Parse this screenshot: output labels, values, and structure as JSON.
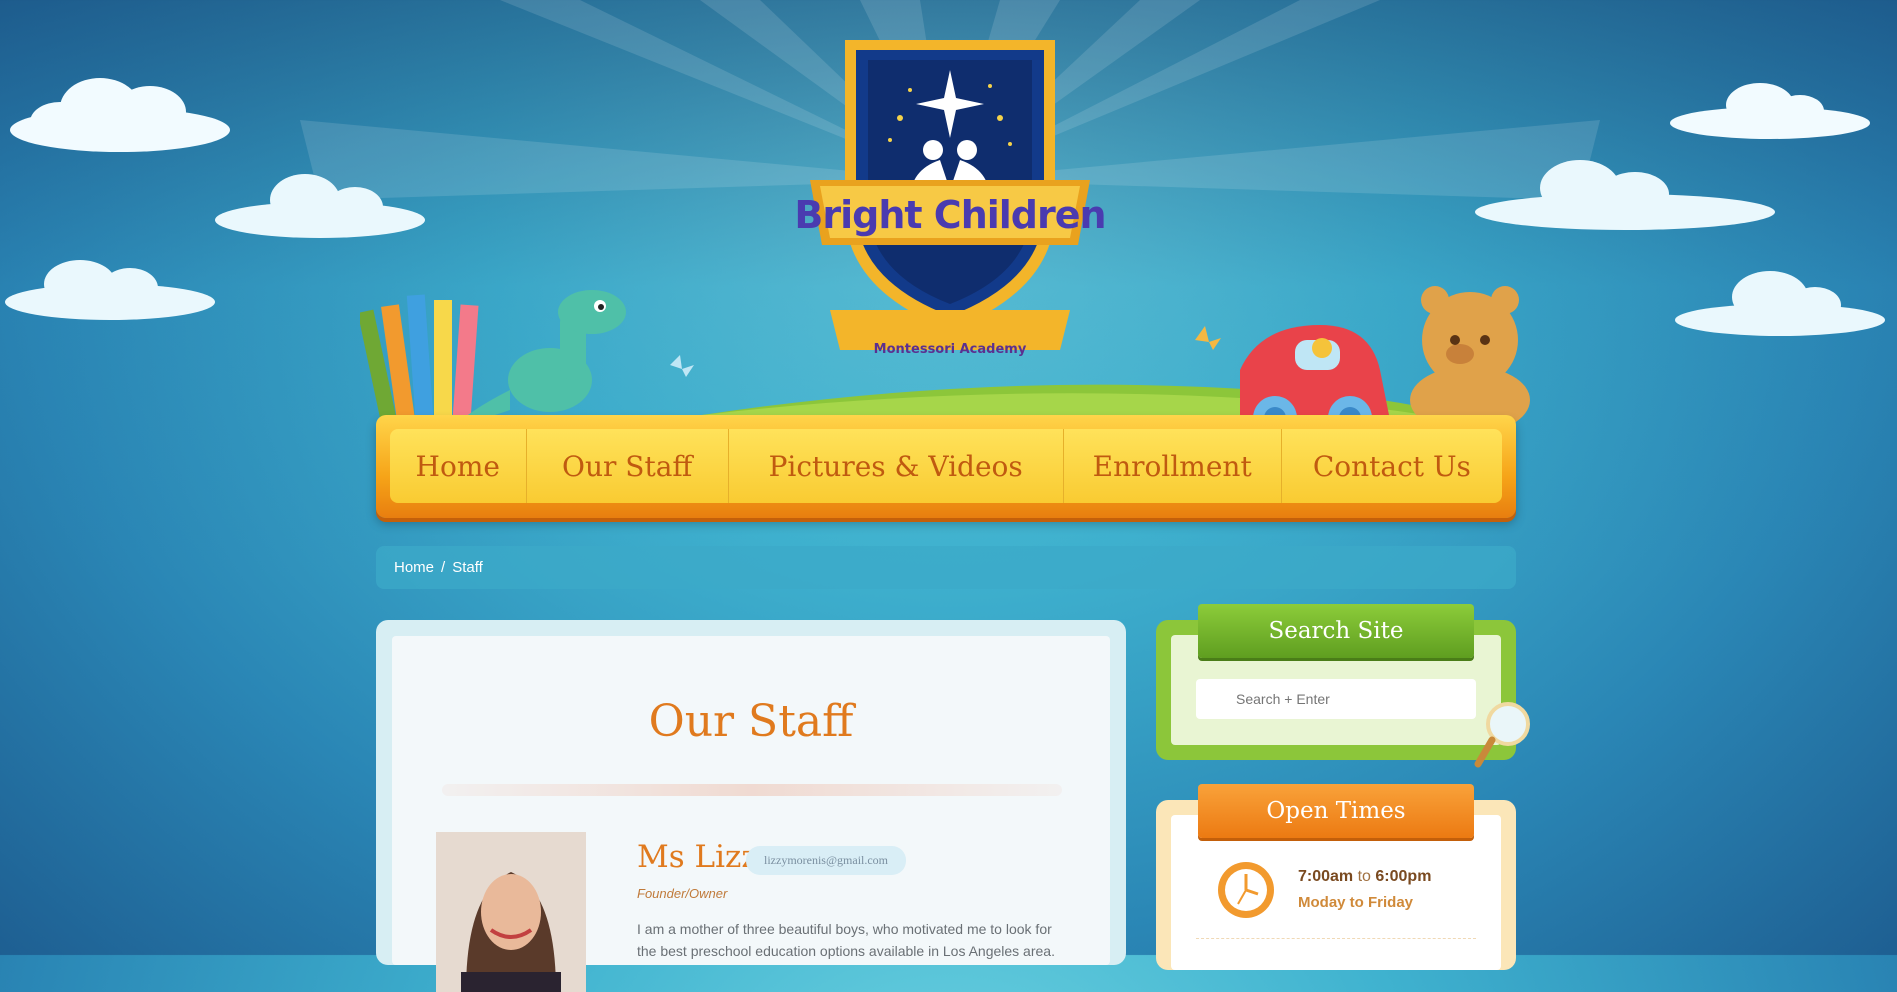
{
  "brand": {
    "title": "Bright Children",
    "subtitle": "Montessori Academy"
  },
  "nav": {
    "items": [
      {
        "label": "Home"
      },
      {
        "label": "Our Staff"
      },
      {
        "label": "Pictures & Videos"
      },
      {
        "label": "Enrollment"
      },
      {
        "label": "Contact Us"
      }
    ]
  },
  "breadcrumb": {
    "home": "Home",
    "separator": "/",
    "current": "Staff"
  },
  "main": {
    "title": "Our Staff",
    "staff": {
      "name": "Ms Lizzy",
      "email": "lizzymorenis@gmail.com",
      "role": "Founder/Owner",
      "bio": "I am a mother of three beautiful boys, who motivated me to look for the best preschool education options available in Los Angeles area."
    }
  },
  "sidebar": {
    "search": {
      "title": "Search Site",
      "placeholder": "Search + Enter"
    },
    "open_times": {
      "title": "Open Times",
      "open": "7:00am",
      "to": "to",
      "close": "6:00pm",
      "days": "Moday to Friday"
    }
  },
  "colors": {
    "accent_orange": "#e07a1e",
    "nav_yellow": "#f9cb32",
    "sky_blue": "#3fb2cf",
    "widget_green": "#8cc63a"
  },
  "icons": {
    "search": "magnifier-icon",
    "clock": "clock-icon"
  }
}
